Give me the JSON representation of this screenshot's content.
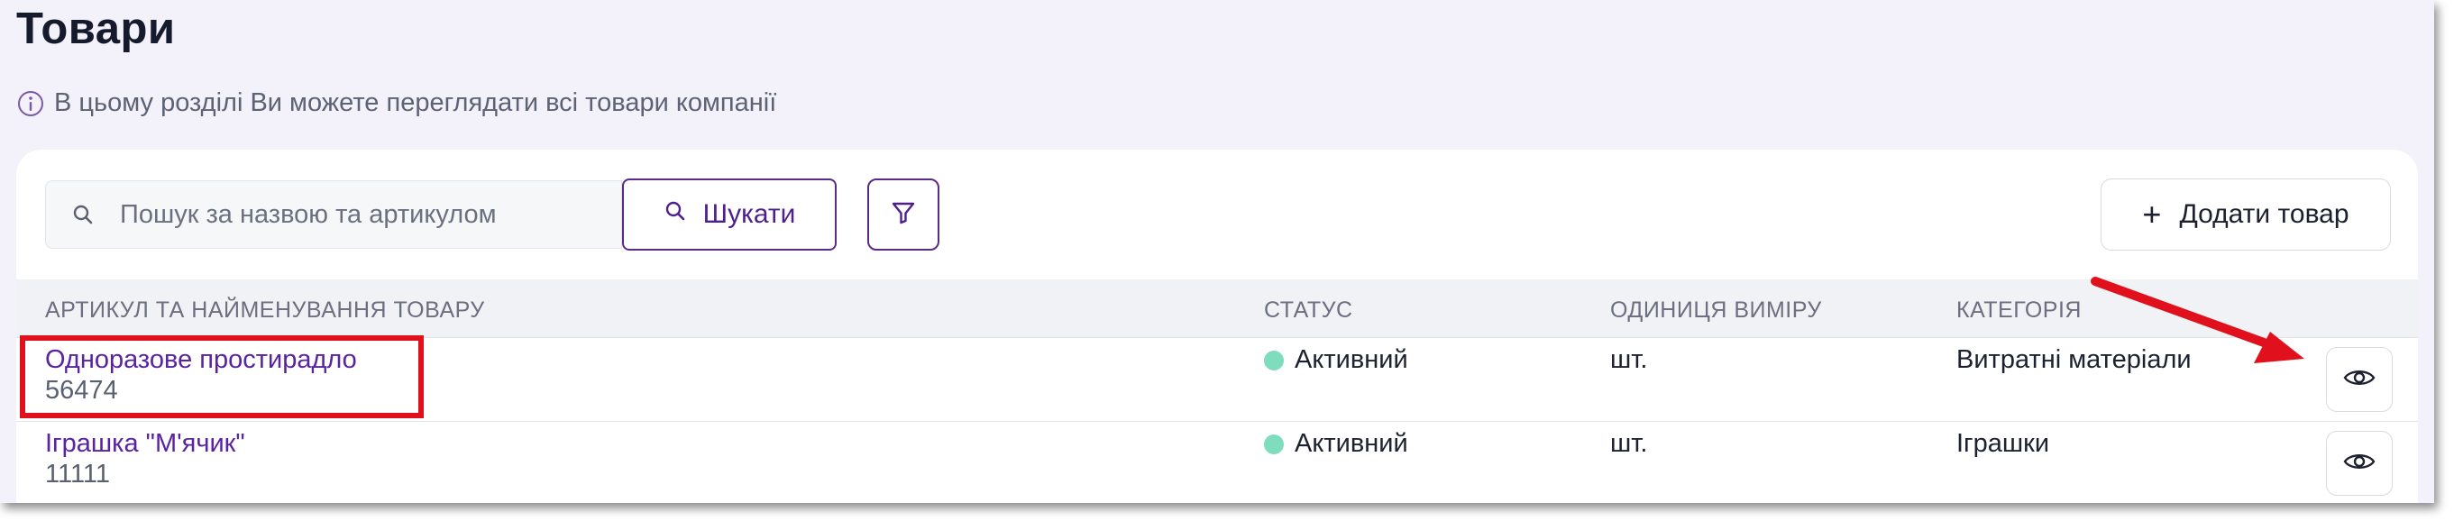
{
  "page": {
    "title": "Товари",
    "info_text": "В цьому розділі Ви можете переглядати всі товари компанії"
  },
  "toolbar": {
    "search_placeholder": "Пошук за назвою та артикулом",
    "search_value": "",
    "search_button_label": "Шукати",
    "add_button_label": "Додати товар",
    "add_button_icon": "+"
  },
  "table": {
    "headers": {
      "product": "АРТИКУЛ ТА НАЙМЕНУВАННЯ ТОВАРУ",
      "status": "СТАТУС",
      "unit": "ОДИНИЦЯ ВИМІРУ",
      "category": "КАТЕГОРІЯ"
    },
    "rows": [
      {
        "name": "Одноразове простирадло",
        "sku": "56474",
        "status": "Активний",
        "unit": "шт.",
        "category": "Витратні матеріали"
      },
      {
        "name": "Іграшка \"М'ячик\"",
        "sku": "11111",
        "status": "Активний",
        "unit": "шт.",
        "category": "Іграшки"
      }
    ]
  },
  "icons": {
    "info": "info-circle-icon",
    "search": "search-icon",
    "filter": "filter-icon",
    "plus": "plus-icon",
    "view": "eye-icon"
  },
  "colors": {
    "accent": "#5a23a0",
    "status_active": "#7fdcbd",
    "highlight": "#e0111c",
    "background": "#f3f1fa"
  }
}
